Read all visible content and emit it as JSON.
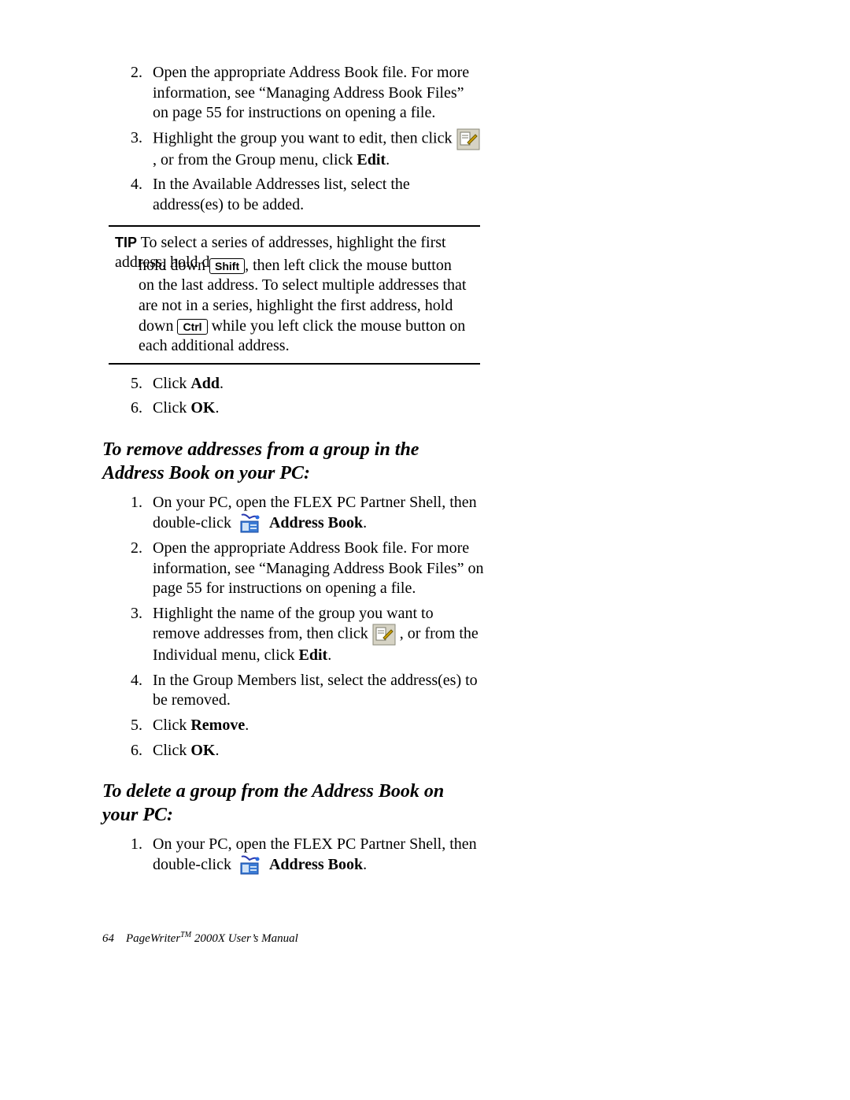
{
  "list1": {
    "i2": {
      "n": "2.",
      "t1": "Open the appropriate Address Book file. For more information, see “Managing Address Book Files” on page 55 for instructions on opening a file."
    },
    "i3": {
      "n": "3.",
      "pre": "Highlight the group you want to edit, then click ",
      "post": " , or from the Group menu, click ",
      "bold": "Edit",
      "tail": "."
    },
    "i4": {
      "n": "4.",
      "t": "In the Available Addresses list, select the address(es) to be added."
    }
  },
  "tip": {
    "label": "TIP",
    "pre": "To select a series of addresses, highlight the first address, hold down ",
    "key1": "Shift",
    "mid1": ", then left click the mouse button on the last address. To select multiple addresses that are not in a series, highlight the first address, hold down ",
    "key2": "Ctrl",
    "post": " while you left click the mouse button on each additional address."
  },
  "list2": {
    "i5": {
      "n": "5.",
      "t1": "Click ",
      "b": "Add",
      "t2": "."
    },
    "i6": {
      "n": "6.",
      "t1": "Click ",
      "b": "OK",
      "t2": "."
    }
  },
  "heading1": "To remove addresses from a group in the Address Book on your PC:",
  "list3": {
    "i1": {
      "n": "1.",
      "t1": "On your PC, open the FLEX PC Partner Shell, then double-click ",
      "b": " Address Book",
      "t2": "."
    },
    "i2": {
      "n": "2.",
      "t": "Open the appropriate Address Book file. For more information, see “Managing Address Book Files” on page 55 for instructions on opening a file."
    },
    "i3": {
      "n": "3.",
      "t1": "Highlight the name of the group you want to remove addresses from, then click ",
      "t2": " , or from the Individual menu, click ",
      "b": "Edit",
      "t3": "."
    },
    "i4": {
      "n": "4.",
      "t": "In the Group Members list, select the address(es) to be removed."
    },
    "i5": {
      "n": "5.",
      "t1": "Click ",
      "b": "Remove",
      "t2": "."
    },
    "i6": {
      "n": "6.",
      "t1": "Click ",
      "b": "OK",
      "t2": "."
    }
  },
  "heading2": "To delete a group from the Address Book on your PC:",
  "list4": {
    "i1": {
      "n": "1.",
      "t1": "On your PC, open the FLEX PC Partner Shell, then double-click ",
      "b": " Address Book",
      "t2": "."
    }
  },
  "footer": {
    "page": "64",
    "title": "PageWriter",
    "tm": "TM",
    "rest": " 2000X User’s Manual"
  }
}
